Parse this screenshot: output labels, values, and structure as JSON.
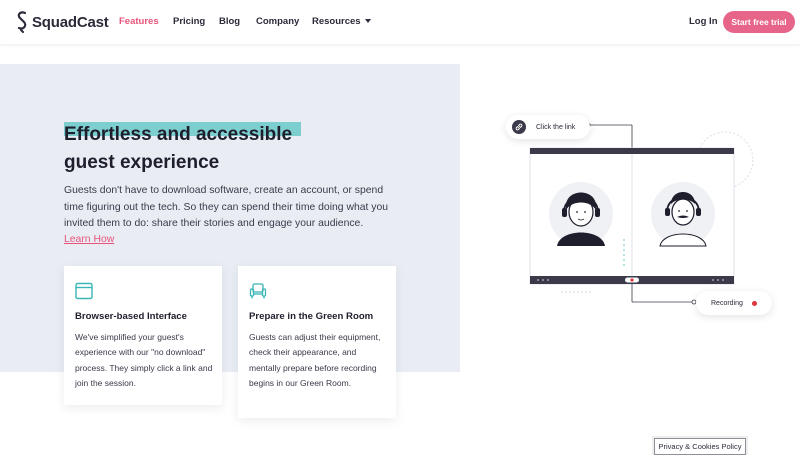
{
  "brand": {
    "name": "SquadCast",
    "accent": "#e8537a",
    "icon": "squadcast-logo-icon"
  },
  "nav": {
    "items": [
      {
        "label": "Features",
        "active": true
      },
      {
        "label": "Pricing"
      },
      {
        "label": "Blog"
      },
      {
        "label": "Company"
      },
      {
        "label": "Resources",
        "dropdown": true
      }
    ],
    "login_label": "Log In",
    "cta_label": "Start free trial"
  },
  "hero": {
    "heading_line1": "Effortless and accessible",
    "heading_line2": "guest experience",
    "description": "Guests don't have to download software, create an account, or spend time figuring out the tech. So they can spend their time doing what you invited them to do: share their stories and engage your audience.",
    "learn_label": "Learn How"
  },
  "features": [
    {
      "icon": "browser-window-icon",
      "title": "Browser-based Interface",
      "body": "We've simplified your guest's experience with our \"no download\" process. They simply click a link and join the session."
    },
    {
      "icon": "armchair-icon",
      "title": "Prepare in the Green Room",
      "body": "Guests can adjust their equipment, check their appearance, and mentally prepare before recording begins in our Green Room."
    }
  ],
  "illustration": {
    "click_label": "Click the link",
    "recording_label": "Recording",
    "link_icon": "link-icon",
    "record_color": "#e0343f"
  },
  "privacy_label": "Privacy & Cookies Policy"
}
